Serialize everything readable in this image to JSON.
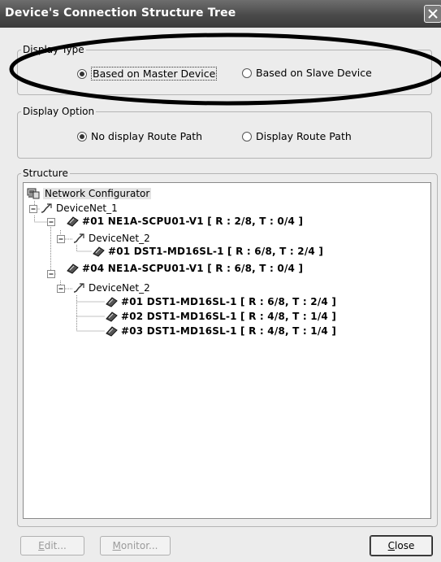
{
  "window": {
    "title": "Device's Connection Structure Tree"
  },
  "display_type": {
    "legend": "Display Type",
    "options": [
      {
        "label": "Based on Master Device",
        "selected": true
      },
      {
        "label": "Based on Slave Device",
        "selected": false
      }
    ]
  },
  "display_option": {
    "legend": "Display Option",
    "options": [
      {
        "label": "No display Route Path",
        "selected": true
      },
      {
        "label": "Display Route Path",
        "selected": false
      }
    ]
  },
  "structure": {
    "legend": "Structure",
    "root": "Network Configurator",
    "network1": "DeviceNet_1",
    "master1": "#01 NE1A-SCPU01-V1 [ R : 2/8, T : 0/4 ]",
    "master1_net": "DeviceNet_2",
    "master1_slave1": "#01 DST1-MD16SL-1 [ R : 6/8, T : 2/4 ]",
    "master2": "#04 NE1A-SCPU01-V1 [ R : 6/8, T : 0/4 ]",
    "master2_net": "DeviceNet_2",
    "master2_slave1": "#01 DST1-MD16SL-1 [ R : 6/8, T : 2/4 ]",
    "master2_slave2": "#02 DST1-MD16SL-1 [ R : 4/8, T : 1/4 ]",
    "master2_slave3": "#03 DST1-MD16SL-1 [ R : 4/8, T : 1/4 ]"
  },
  "buttons": {
    "edit_first": "E",
    "edit_rest": "dit...",
    "monitor_first": "M",
    "monitor_rest": "onitor...",
    "close_first": "C",
    "close_rest": "lose"
  },
  "colors": {
    "titlebar": "#4a4a4a",
    "window_bg": "#ececec",
    "annotation_ellipse": "#000000"
  }
}
